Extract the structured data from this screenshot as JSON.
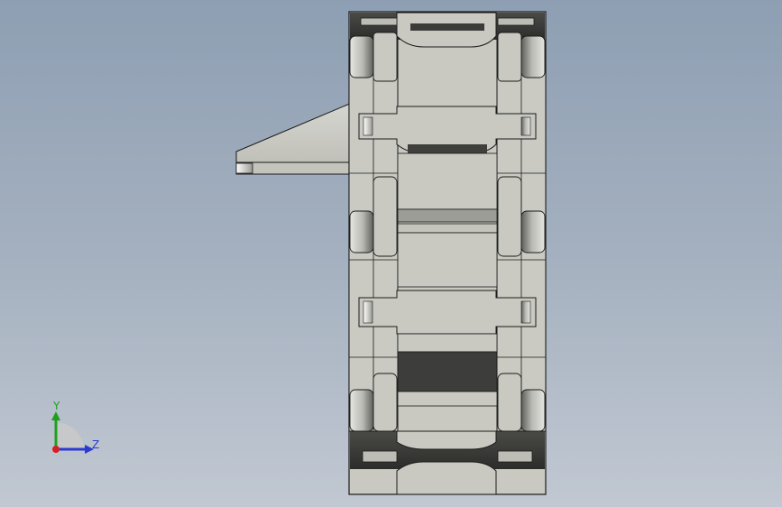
{
  "viewport": {
    "background_top": "#8e9fb3",
    "background_bottom": "#c1c8d2"
  },
  "model": {
    "part_color": "#c9c9c2",
    "edge_color": "#1a1a1a",
    "shadow_color": "#3a3a38"
  },
  "triad": {
    "y_label": "Y",
    "z_label": "Z",
    "y_color": "#1ea01e",
    "z_color": "#2a3ad0",
    "x_color": "#d42020"
  }
}
